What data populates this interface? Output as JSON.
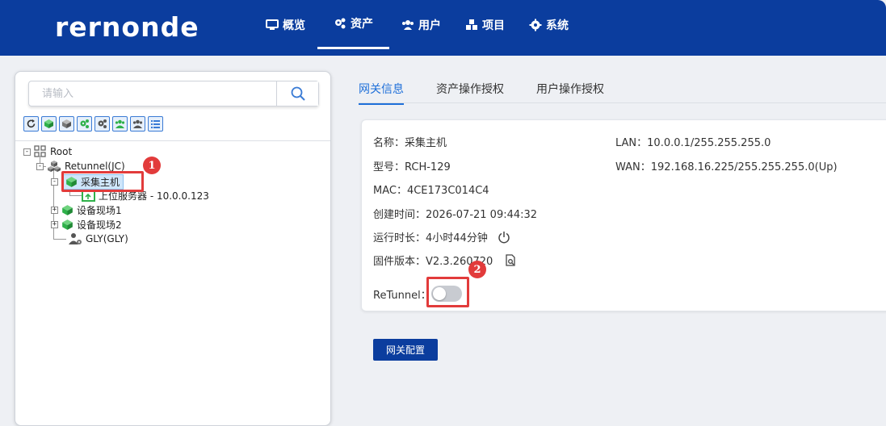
{
  "header": {
    "logo": "rernonde",
    "nav": [
      {
        "label": "概览",
        "icon": "monitor-icon"
      },
      {
        "label": "资产",
        "icon": "gears-icon"
      },
      {
        "label": "用户",
        "icon": "users-icon"
      },
      {
        "label": "项目",
        "icon": "cubes-icon"
      },
      {
        "label": "系统",
        "icon": "gear-icon"
      }
    ],
    "active_nav": "资产"
  },
  "sidebar": {
    "search_placeholder": "请输入",
    "toolbar_icons": [
      "refresh-icon",
      "cube-green-icon",
      "cube-gray-icon",
      "gears-green-icon",
      "gears-gray-icon",
      "users-green-icon",
      "users-gray-icon",
      "list-icon"
    ],
    "tree": {
      "root": "Root",
      "retunnel": "Retunnel(JC)",
      "host": "采集主机",
      "server": "上位服务器 - 10.0.0.123",
      "site1": "设备现场1",
      "site2": "设备现场2",
      "user": "GLY(GLY)"
    }
  },
  "tabs": [
    "网关信息",
    "资产操作授权",
    "用户操作授权"
  ],
  "active_tab": "网关信息",
  "gateway_info": {
    "name": "名称：采集主机",
    "model": "型号：RCH-129",
    "mac": "MAC：4CE173C014C4",
    "created": "创建时间：2026-07-21 09:44:32",
    "uptime": "运行时长：4小时44分钟",
    "firmware": "固件版本：V2.3.260720",
    "lan": "LAN：10.0.0.1/255.255.255.0",
    "wan": "WAN：192.168.16.225/255.255.255.0(Up)",
    "retunnel_label": "ReTunnel：",
    "retunnel_enabled": false
  },
  "config_button": "网关配置",
  "annotations": [
    "1",
    "2"
  ],
  "colors": {
    "brand": "#0b3d9e",
    "accent": "#1e6fd9",
    "highlight": "#e23b3b",
    "node_green": "#2fb14a"
  }
}
